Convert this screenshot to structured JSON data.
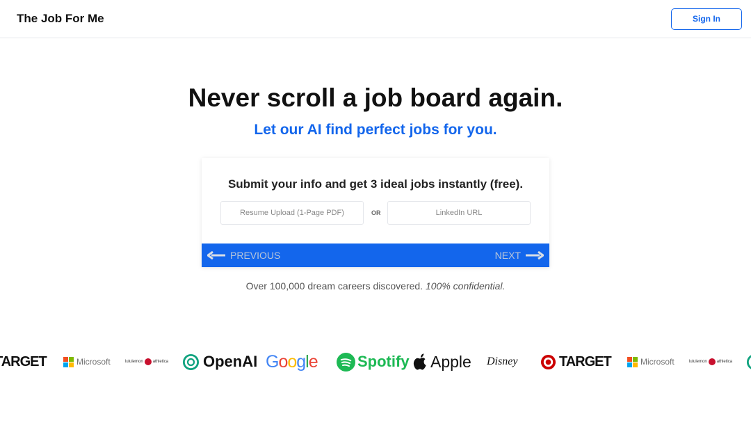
{
  "header": {
    "brand": "The Job For Me",
    "sign_in": "Sign In"
  },
  "hero": {
    "title": "Never scroll a job board again.",
    "subtitle": "Let our AI find perfect jobs for you."
  },
  "card": {
    "title": "Submit your info and get 3 ideal jobs instantly (free).",
    "resume_placeholder": "Resume Upload (1-Page PDF)",
    "or": "OR",
    "linkedin_placeholder": "LinkedIn URL",
    "previous": "PREVIOUS",
    "next": "NEXT"
  },
  "colors": {
    "accent": "#1366ec"
  },
  "tagline": {
    "text": "Over 100,000 dream careers discovered.",
    "emphasis": "100% confidential."
  },
  "logos": [
    "Target",
    "Microsoft",
    "lululemon athletica",
    "OpenAI",
    "Google",
    "Spotify",
    "Apple",
    "Disney",
    "Target",
    "Microsoft",
    "lululemon athletica",
    "OpenAI"
  ]
}
